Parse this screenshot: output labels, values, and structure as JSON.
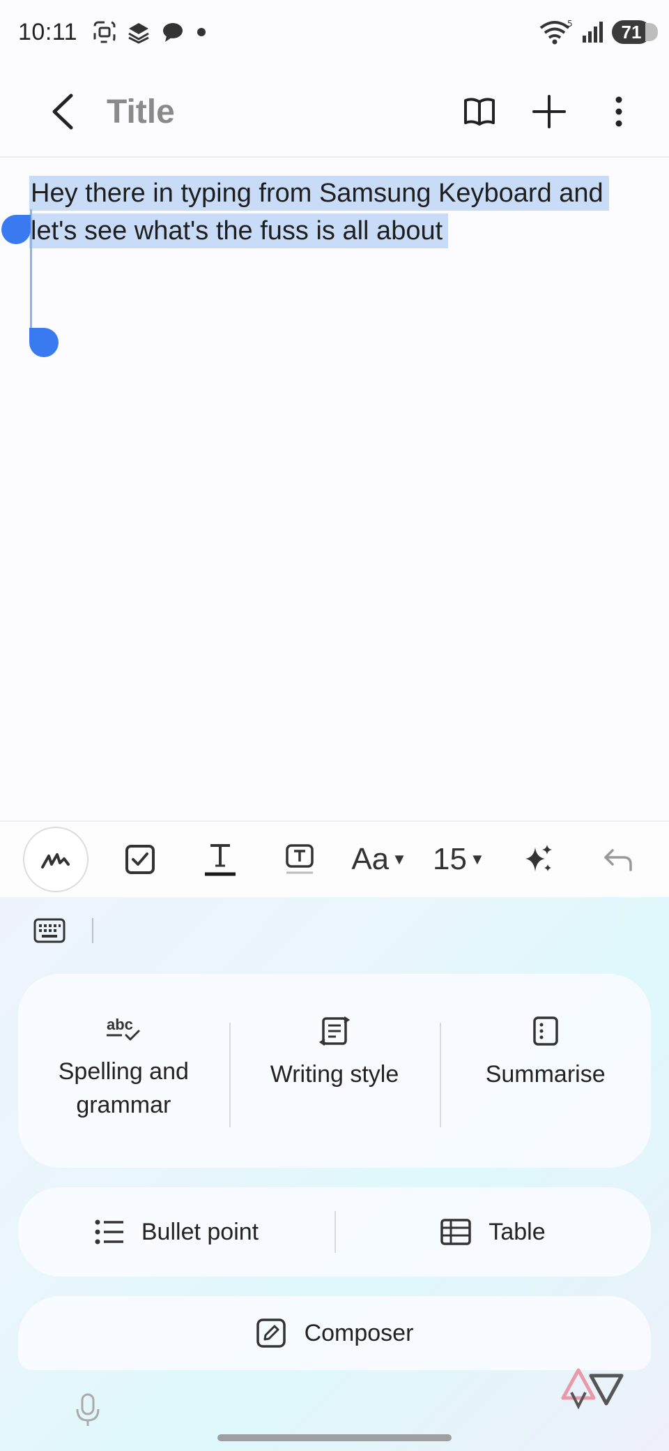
{
  "status_bar": {
    "time": "10:11",
    "wifi_badge": "5",
    "battery_level": "71"
  },
  "app_bar": {
    "title": "Title",
    "icons": [
      "back-icon",
      "book-icon",
      "plus-icon",
      "more-vert-icon"
    ]
  },
  "note": {
    "selected_text": "Hey there in typing from Samsung Keyboard and let's see what's the fuss is all about"
  },
  "format_toolbar": {
    "font_style_label": "Aa",
    "font_size_label": "15",
    "icons": [
      "handwriting-pen-icon",
      "checkbox-icon",
      "text-style-icon",
      "text-box-icon",
      "sparkle-ai-icon",
      "undo-icon"
    ]
  },
  "writing_assist": {
    "spelling": "Spelling and grammar",
    "writing_style": "Writing style",
    "summarise": "Summarise",
    "bullet_point": "Bullet point",
    "table": "Table",
    "composer": "Composer"
  },
  "colors": {
    "accent": "#3a7af0",
    "selection": "#c9dcf7",
    "title_grey": "#8a8a8a"
  }
}
